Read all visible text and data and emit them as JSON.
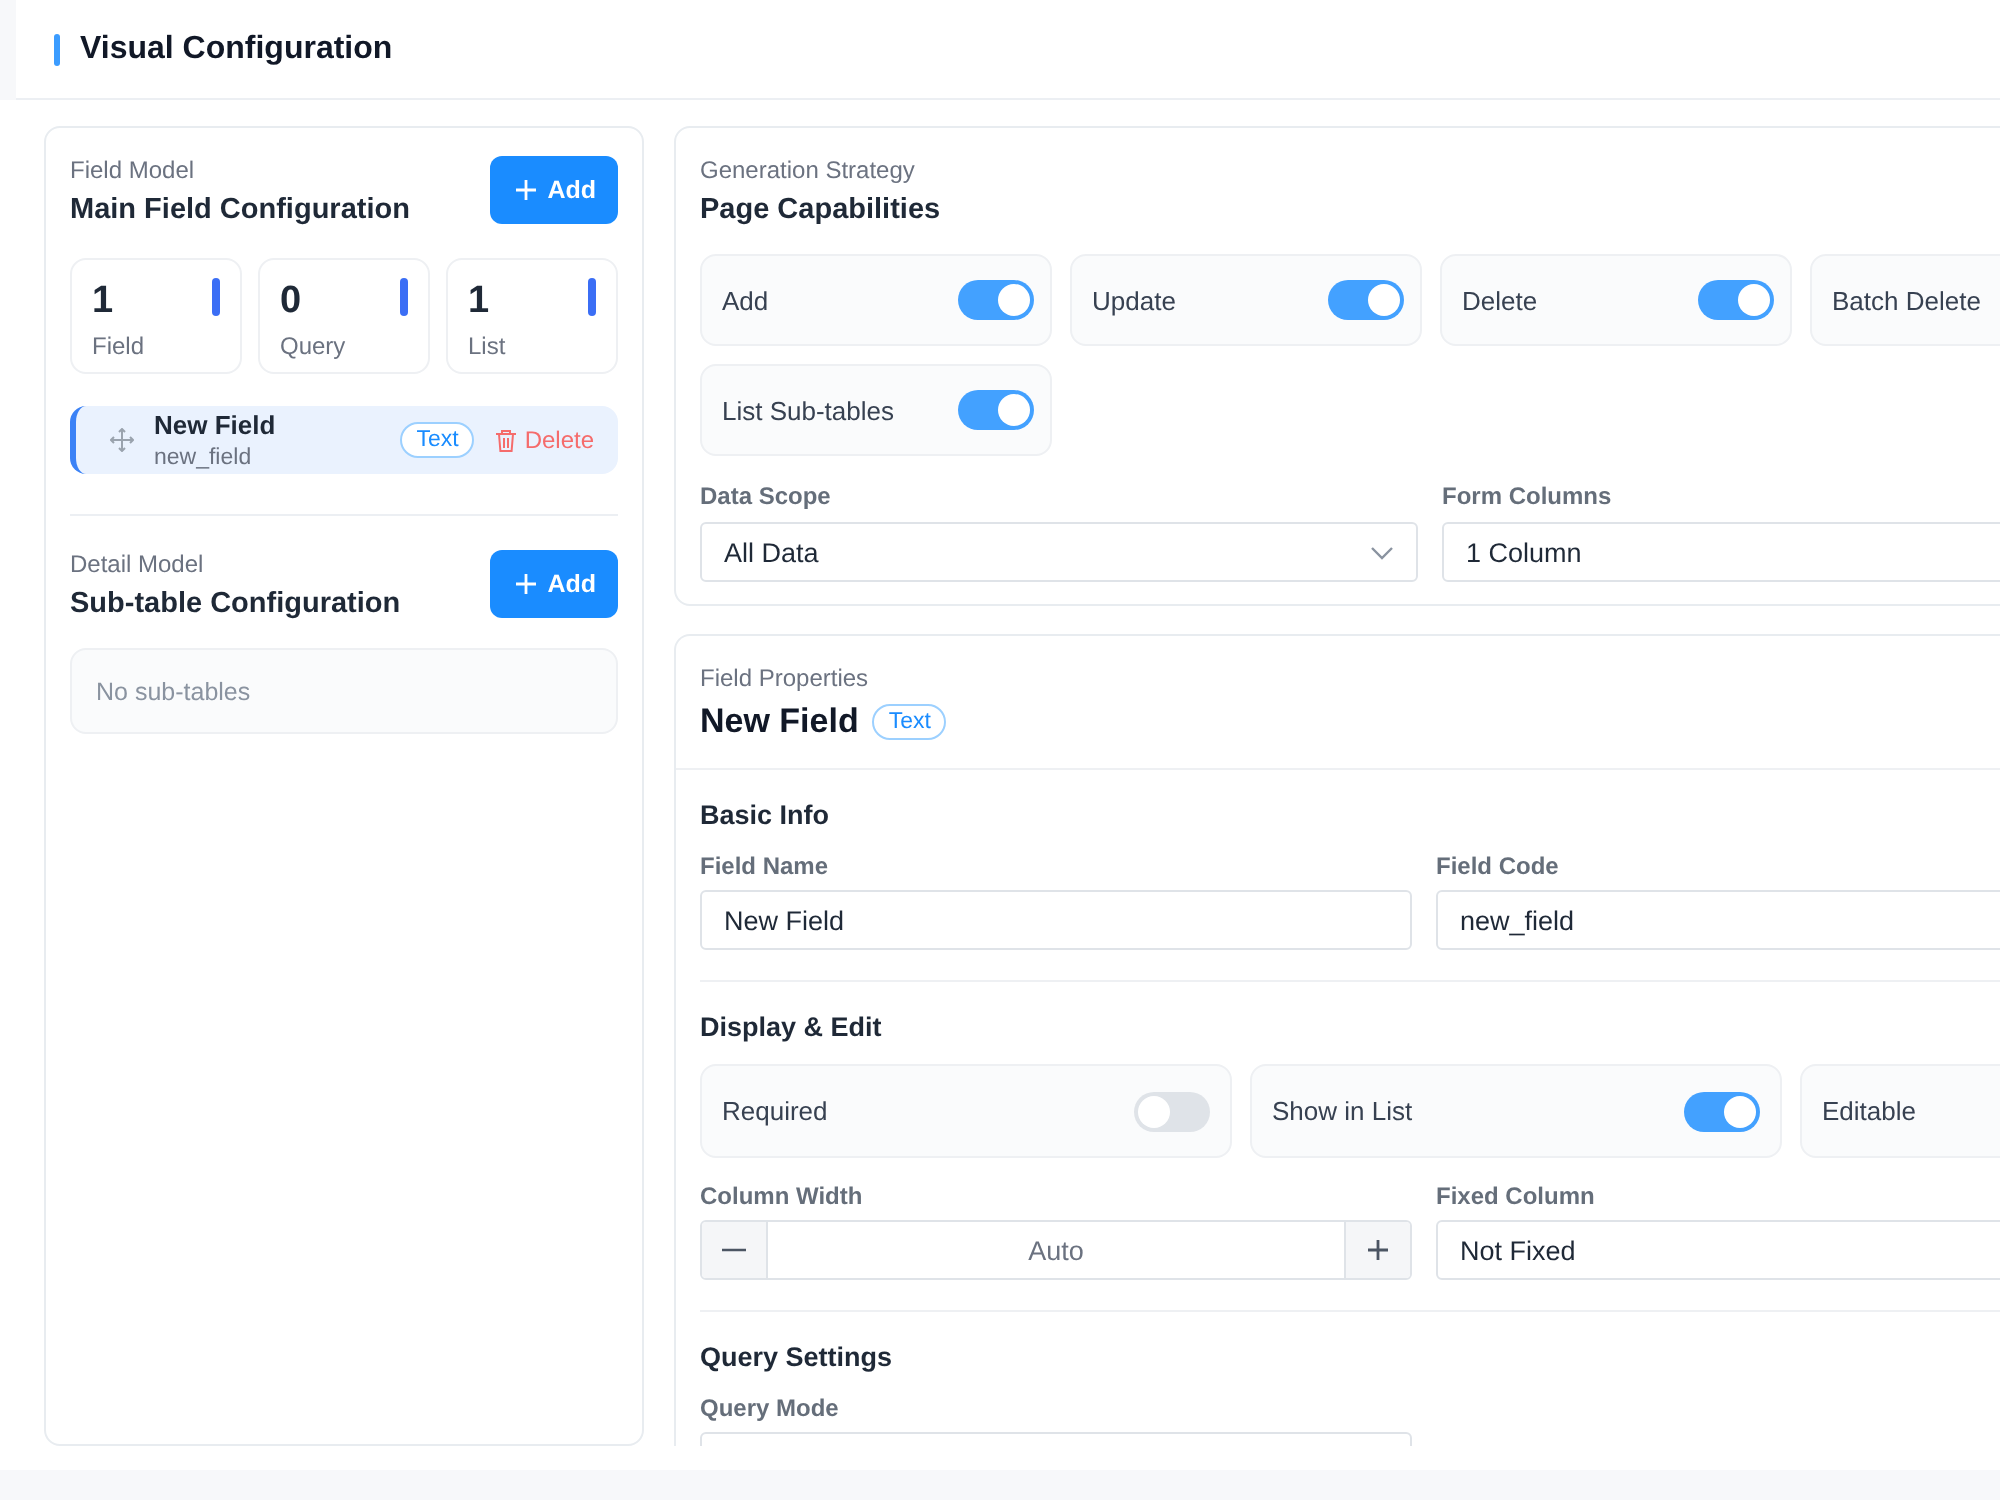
{
  "header": {
    "title": "Visual Configuration"
  },
  "main_model": {
    "caption": "Field Model",
    "title": "Main Field Configuration",
    "add_button": "Add",
    "stats": [
      {
        "value": "1",
        "label": "Field"
      },
      {
        "value": "0",
        "label": "Query"
      },
      {
        "value": "1",
        "label": "List"
      }
    ],
    "fields": [
      {
        "name": "New Field",
        "code": "new_field",
        "type": "Text",
        "delete": "Delete",
        "selected": true
      }
    ]
  },
  "detail_model": {
    "caption": "Detail Model",
    "title": "Sub-table Configuration",
    "add_button": "Add",
    "empty_text": "No sub-tables"
  },
  "capabilities": {
    "caption": "Generation Strategy",
    "title": "Page Capabilities",
    "items": [
      {
        "label": "Add",
        "on": true
      },
      {
        "label": "Update",
        "on": true
      },
      {
        "label": "Delete",
        "on": true
      },
      {
        "label": "Batch Delete"
      },
      {
        "label": "List Sub-tables",
        "on": true
      }
    ],
    "selects": [
      {
        "label": "Data Scope",
        "value": "All Data",
        "chevron": true
      },
      {
        "label": "Form Columns",
        "value": "1 Column"
      }
    ]
  },
  "field_properties": {
    "caption": "Field Properties",
    "title": "New Field",
    "type": "Text",
    "sections": [
      {
        "title": "Basic Info",
        "controls": [
          {
            "kind": "input",
            "label": "Field Name",
            "value": "New Field"
          },
          {
            "kind": "input",
            "label": "Field Code",
            "value": "new_field"
          }
        ]
      },
      {
        "title": "Display & Edit",
        "toggles": [
          {
            "label": "Required",
            "on": false
          },
          {
            "label": "Show in List",
            "on": true
          },
          {
            "label": "Editable"
          }
        ],
        "controls": [
          {
            "kind": "stepper",
            "label": "Column Width",
            "value": "Auto"
          },
          {
            "kind": "select",
            "label": "Fixed Column",
            "value": "Not Fixed"
          }
        ]
      },
      {
        "title": "Query Settings",
        "controls": [
          {
            "kind": "input",
            "label": "Query Mode"
          }
        ]
      }
    ]
  }
}
